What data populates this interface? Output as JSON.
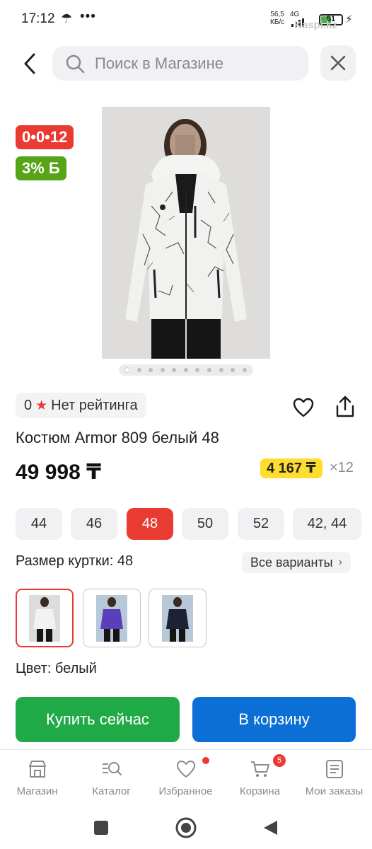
{
  "status_bar": {
    "time": "17:12",
    "umbrella_icon": "umbrella-icon",
    "more": "•••",
    "speed_value": "56,5",
    "speed_unit": "КБ/с",
    "network": "4G",
    "battery": "51",
    "battery_level": 0.51,
    "watermark": "Kaspi.kz"
  },
  "header": {
    "search_placeholder": "Поиск в Магазине"
  },
  "product": {
    "installment_badge": "0•0•12",
    "bonus_badge": "3% Б",
    "image_count": 11,
    "active_image": 0,
    "rating_value": "0",
    "rating_text": "Нет рейтинга",
    "title": "Костюм Armor 809 белый 48",
    "price": "49 998 ₸",
    "monthly_payment": "4 167 ₸",
    "monthly_count": "×12",
    "sizes": [
      "44",
      "46",
      "48",
      "50",
      "52",
      "42, 44"
    ],
    "selected_size": "48",
    "size_label": "Размер куртки: 48",
    "all_variants": "Все варианты",
    "color_label": "Цвет: белый",
    "colors": [
      {
        "name": "white",
        "jacket": "#f2f2f2",
        "selected": true
      },
      {
        "name": "purple",
        "jacket": "#5b3fb8",
        "selected": false
      },
      {
        "name": "navy",
        "jacket": "#1a2233",
        "selected": false
      }
    ]
  },
  "actions": {
    "buy_now": "Купить сейчас",
    "to_cart": "В корзину"
  },
  "bottom_nav": {
    "items": [
      {
        "label": "Магазин",
        "icon": "shop-icon"
      },
      {
        "label": "Каталог",
        "icon": "catalog-icon"
      },
      {
        "label": "Избранное",
        "icon": "heart-icon"
      },
      {
        "label": "Корзина",
        "icon": "cart-icon",
        "badge": "5"
      },
      {
        "label": "Мои заказы",
        "icon": "orders-icon"
      }
    ]
  },
  "colors": {
    "accent_red": "#ea3b33",
    "bonus_green": "#57a418",
    "buy_green": "#1faa47",
    "cart_blue": "#0c6fd6",
    "monthly_yellow": "#ffdd2d"
  }
}
